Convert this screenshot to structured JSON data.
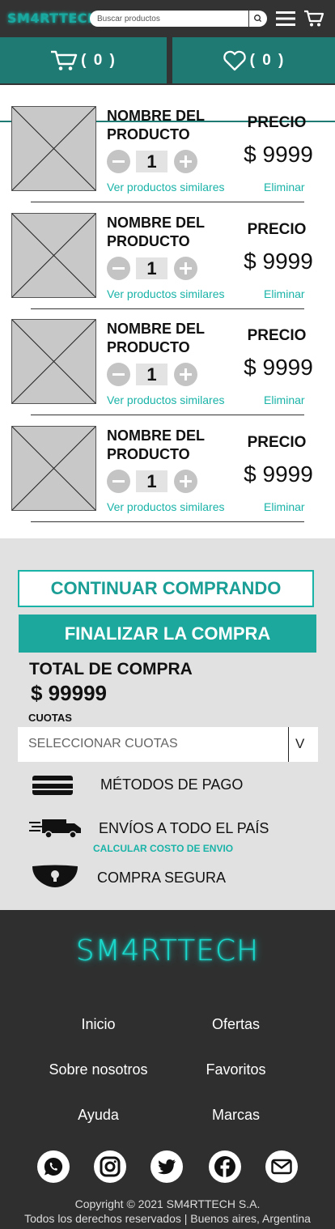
{
  "header": {
    "logo": "SM4RTTECH",
    "search_placeholder": "Buscar productos"
  },
  "tabs": {
    "cart_count": "( 0 )",
    "fav_count": "( 0 )"
  },
  "products": [
    {
      "name": "NOMBRE DEL PRODUCTO",
      "qty": "1",
      "price_label": "PRECIO",
      "price": "$ 9999",
      "similar": "Ver productos similares",
      "remove": "Eliminar"
    },
    {
      "name": "NOMBRE DEL PRODUCTO",
      "qty": "1",
      "price_label": "PRECIO",
      "price": "$ 9999",
      "similar": "Ver productos similares",
      "remove": "Eliminar"
    },
    {
      "name": "NOMBRE DEL PRODUCTO",
      "qty": "1",
      "price_label": "PRECIO",
      "price": "$ 9999",
      "similar": "Ver productos similares",
      "remove": "Eliminar"
    },
    {
      "name": "NOMBRE DEL PRODUCTO",
      "qty": "1",
      "price_label": "PRECIO",
      "price": "$ 9999",
      "similar": "Ver productos similares",
      "remove": "Eliminar"
    }
  ],
  "summary": {
    "continue_label": "CONTINUAR COMPRANDO",
    "checkout_label": "FINALIZAR LA COMPRA",
    "total_label": "TOTAL DE COMPRA",
    "total_value": "$ 99999",
    "cuotas_label": "CUOTAS",
    "cuotas_placeholder": "SELECCIONAR CUOTAS",
    "cuotas_arrow": "V",
    "payment_methods": "MÉTODOS DE PAGO",
    "shipping": "ENVÍOS A TODO EL PAÍS",
    "shipping_link": "CALCULAR COSTO DE ENVIO",
    "secure": "COMPRA SEGURA"
  },
  "footer": {
    "brand": "SM4RTTECH",
    "links": [
      "Inicio",
      "Ofertas",
      "Sobre nosotros",
      "Favoritos",
      "Ayuda",
      "Marcas"
    ],
    "social": [
      "whatsapp-icon",
      "instagram-icon",
      "twitter-icon",
      "facebook-icon",
      "mail-icon"
    ],
    "copyright": "Copyright © 2021 SM4RTTECH S.A.",
    "rights": "Todos los derechos reservados | Buenos aires, Argentina"
  },
  "colors": {
    "accent": "#1ab3a8",
    "tab_bg": "#1f7a73",
    "header_bg": "#333333",
    "footer_bg": "#2f2f2f",
    "summary_bg": "#e1e1e1"
  }
}
